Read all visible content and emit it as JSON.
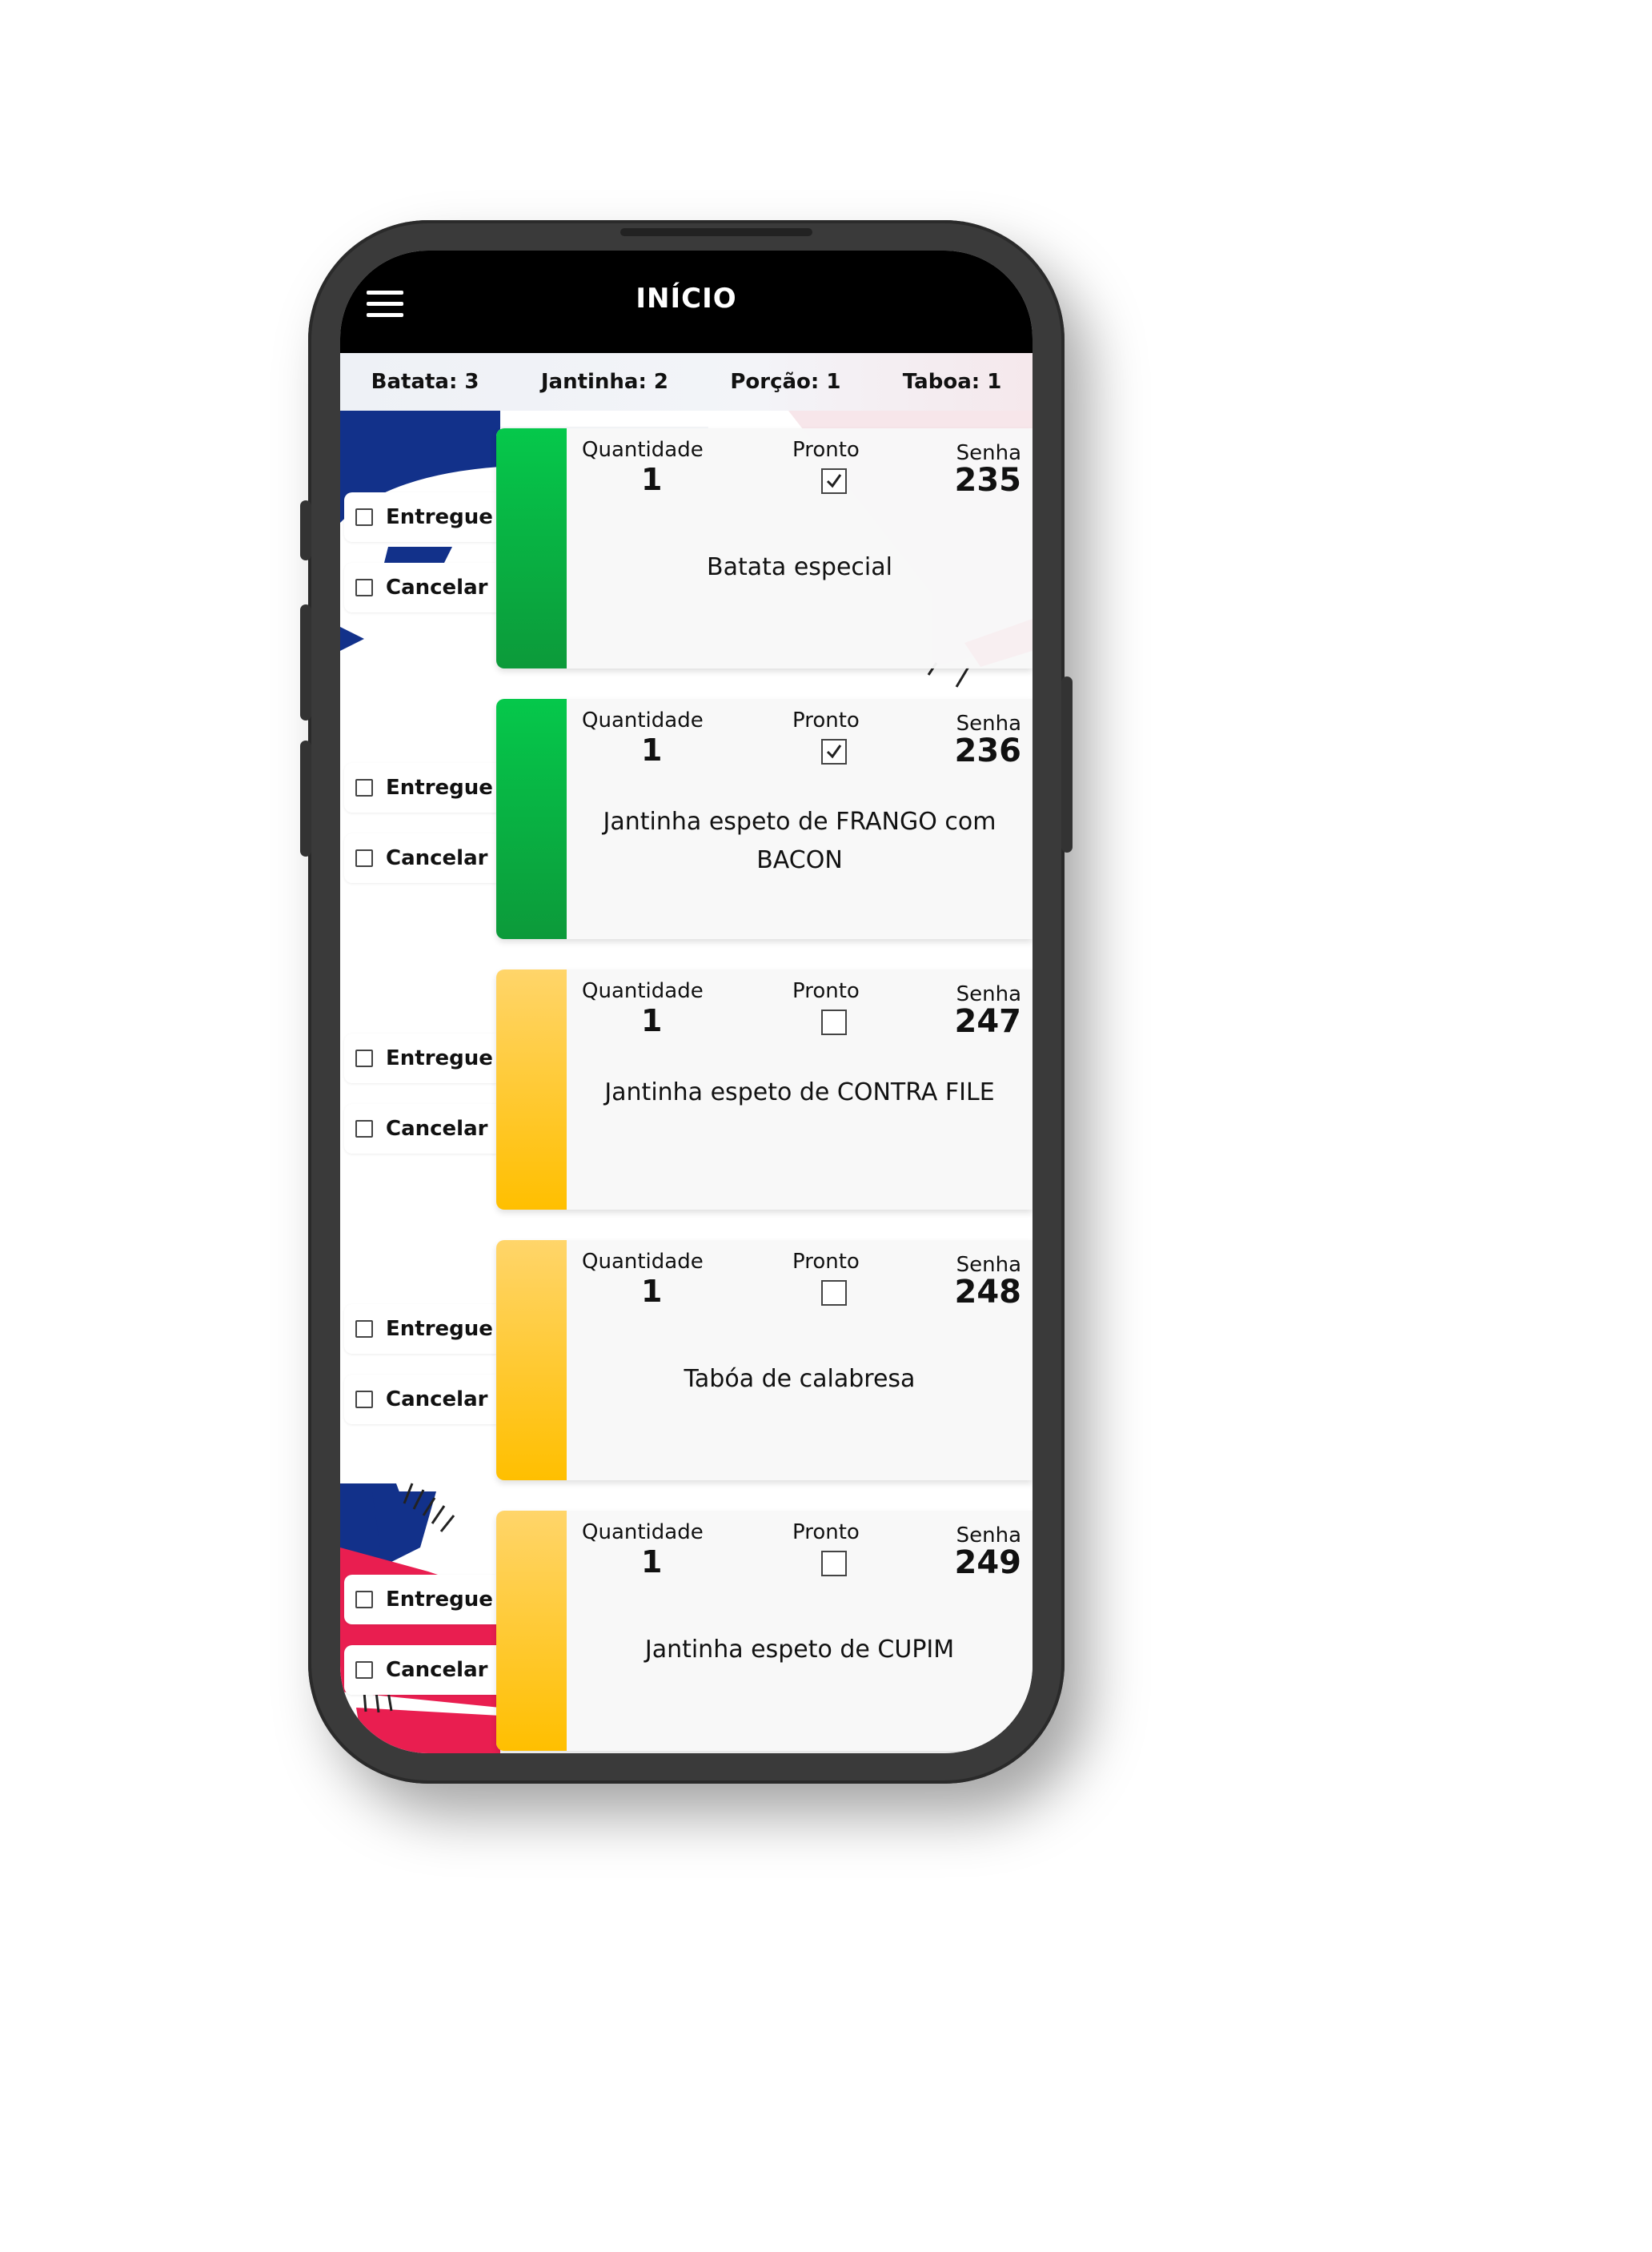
{
  "header": {
    "title": "INÍCIO"
  },
  "summary": [
    {
      "label": "Batata: 3"
    },
    {
      "label": "Jantinha: 2"
    },
    {
      "label": "Porção: 1"
    },
    {
      "label": "Taboa: 1"
    }
  ],
  "labels": {
    "quantity": "Quantidade",
    "ready": "Pronto",
    "ticket": "Senha",
    "delivered": "Entregue",
    "cancel": "Cancelar"
  },
  "orders": [
    {
      "quantity": "1",
      "ticket": "235",
      "product": "Batata especial",
      "ready": true,
      "status_color": "green"
    },
    {
      "quantity": "1",
      "ticket": "236",
      "product": "Jantinha espeto de FRANGO com BACON",
      "ready": true,
      "status_color": "green"
    },
    {
      "quantity": "1",
      "ticket": "247",
      "product": "Jantinha espeto de CONTRA FILE",
      "ready": false,
      "status_color": "yellow"
    },
    {
      "quantity": "1",
      "ticket": "248",
      "product": "Tabóa de calabresa",
      "ready": false,
      "status_color": "yellow"
    },
    {
      "quantity": "1",
      "ticket": "249",
      "product": "Jantinha espeto de CUPIM",
      "ready": false,
      "status_color": "yellow"
    }
  ],
  "colors": {
    "ready_green": "#0cb944",
    "pending_yellow": "#ffc61a",
    "header": "#000000"
  }
}
